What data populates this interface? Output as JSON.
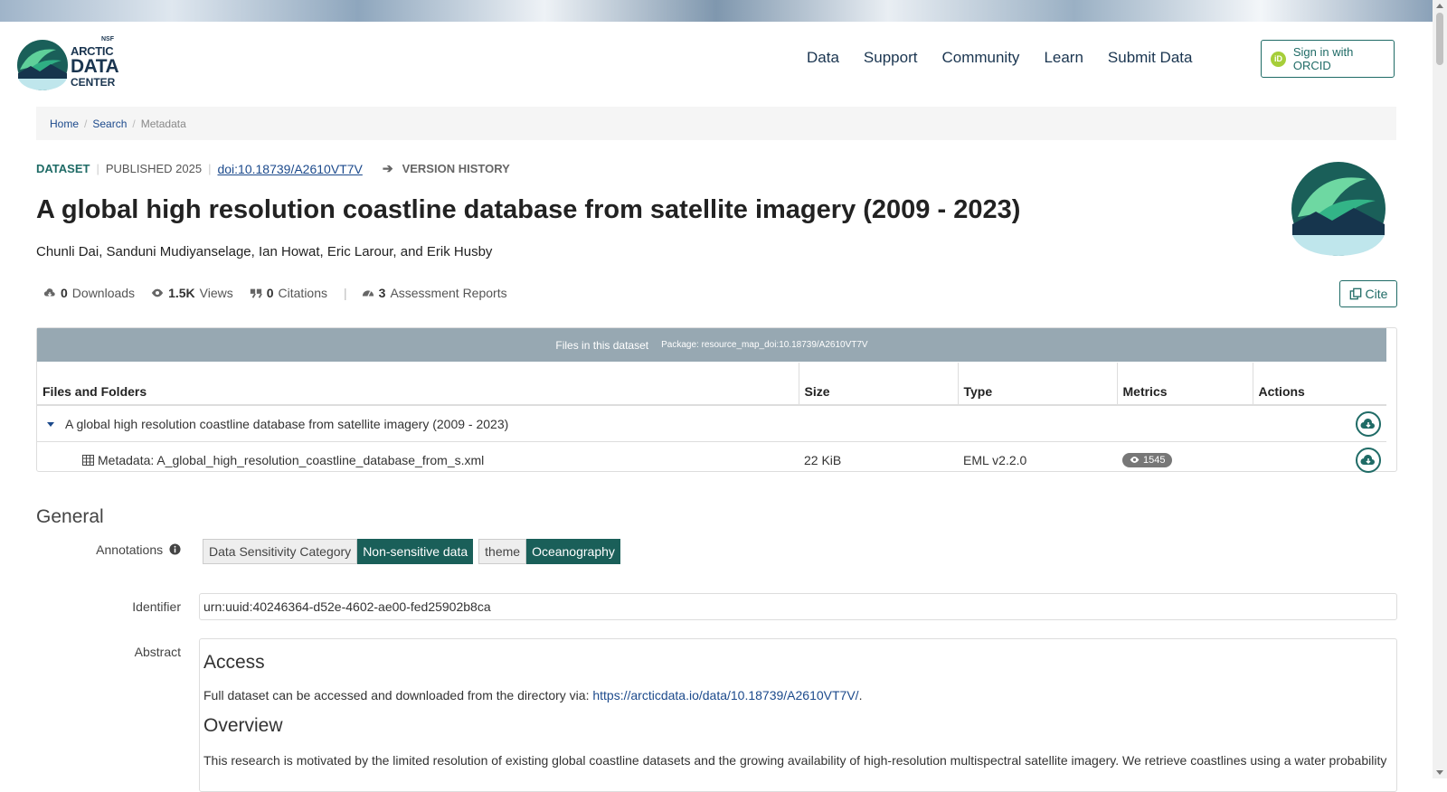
{
  "header": {
    "logo": {
      "nsf": "NSF",
      "line1": "ARCTIC",
      "line2": "DATA",
      "line3": "CENTER"
    },
    "nav": [
      "Data",
      "Support",
      "Community",
      "Learn",
      "Submit Data"
    ],
    "signin": {
      "icon_text": "iD",
      "label": "Sign in with ORCID"
    }
  },
  "breadcrumb": {
    "home": "Home",
    "search": "Search",
    "current": "Metadata",
    "sep": "/"
  },
  "dataset": {
    "type": "DATASET",
    "published": "PUBLISHED 2025",
    "doi": "doi:10.18739/A2610VT7V",
    "version_history": "VERSION HISTORY",
    "title": "A global high resolution coastline database from satellite imagery (2009 - 2023)",
    "authors": "Chunli Dai, Sanduni Mudiyanselage, Ian Howat, Eric Larour, and Erik Husby"
  },
  "metrics": {
    "downloads_count": "0",
    "downloads_label": "Downloads",
    "views_count": "1.5K",
    "views_label": "Views",
    "citations_count": "0",
    "citations_label": "Citations",
    "reports_count": "3",
    "reports_label": "Assessment Reports"
  },
  "cite": {
    "label": "Cite"
  },
  "files": {
    "heading": "Files in this dataset",
    "package": "Package: resource_map_doi:10.18739/A2610VT7V",
    "columns": [
      "Files and Folders",
      "Size",
      "Type",
      "Metrics",
      "Actions"
    ],
    "folder": {
      "name": "A global high resolution coastline database from satellite imagery (2009 - 2023)"
    },
    "rows": [
      {
        "name": "Metadata: A_global_high_resolution_coastline_database_from_s.xml",
        "size": "22 KiB",
        "type": "EML v2.2.0",
        "views": "1545"
      }
    ]
  },
  "general": {
    "title": "General",
    "annotations_label": "Annotations",
    "annotations": [
      {
        "key": "Data Sensitivity Category",
        "value": "Non-sensitive data"
      },
      {
        "key": "theme",
        "value": "Oceanography"
      }
    ],
    "identifier_label": "Identifier",
    "identifier": "urn:uuid:40246364-d52e-4602-ae00-fed25902b8ca",
    "abstract_label": "Abstract",
    "abstract": {
      "h1": "Access",
      "p1_text": "Full dataset can be accessed and downloaded from the directory via: ",
      "p1_link": "https://arcticdata.io/data/10.18739/A2610VT7V/",
      "p1_end": ".",
      "h2": "Overview",
      "p2": "This research is motivated by the limited resolution of existing global coastline datasets and the growing availability of high-resolution multispectral satellite imagery. We retrieve coastlines using a water probability"
    }
  },
  "colors": {
    "accent": "#1f6b66",
    "link": "#1c4a8c",
    "table_header": "#97a8b2"
  }
}
